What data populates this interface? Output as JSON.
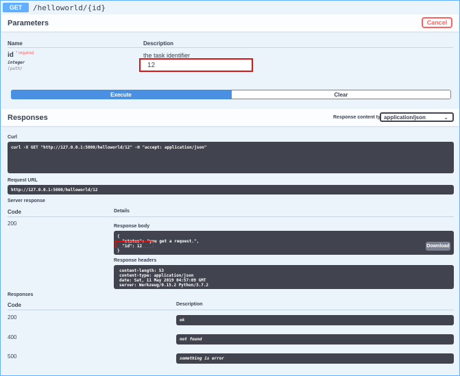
{
  "summary": {
    "method": "GET",
    "path": "/helloworld/{id}"
  },
  "parameters": {
    "title": "Parameters",
    "cancel_label": "Cancel",
    "col_name": "Name",
    "col_description": "Description",
    "param": {
      "name": "id",
      "required_label": "* required",
      "type": "integer",
      "in": "(path)",
      "description": "the task identifier",
      "value": "12"
    }
  },
  "actions": {
    "execute_label": "Execute",
    "clear_label": "Clear"
  },
  "responses_header": {
    "title": "Responses",
    "content_type_label": "Response content type",
    "content_type_value": "application/json"
  },
  "curl": {
    "label": "Curl",
    "command": "curl -X GET \"http://127.0.0.1:5000/helloworld/12\" -H \"accept: application/json\""
  },
  "request_url": {
    "label": "Request URL",
    "value": "http://127.0.0.1:5000/helloworld/12"
  },
  "server_response": {
    "label": "Server response",
    "col_code": "Code",
    "col_details": "Details",
    "code": "200",
    "body_label": "Response body",
    "body_lines": [
      "{",
      "  \"status\": \"you get a request.\",",
      "  \"id\": 12",
      "}"
    ],
    "download_label": "Download",
    "headers_label": "Response headers",
    "header_lines": [
      "content-length: 53",
      "content-type: application/json",
      "date: Sat, 11 May 2019 04:57:09 GMT",
      "server: Werkzeug/0.15.2 Python/3.7.2"
    ]
  },
  "documented_responses": {
    "label": "Responses",
    "col_code": "Code",
    "col_description": "Description",
    "rows": [
      {
        "code": "200",
        "description": "ok"
      },
      {
        "code": "400",
        "description": "not found"
      },
      {
        "code": "500",
        "description": "something is error"
      }
    ]
  },
  "colors": {
    "get": "#61affe",
    "execute": "#4990e2",
    "cancel": "#ff6060",
    "dark_panel": "#41444e"
  }
}
